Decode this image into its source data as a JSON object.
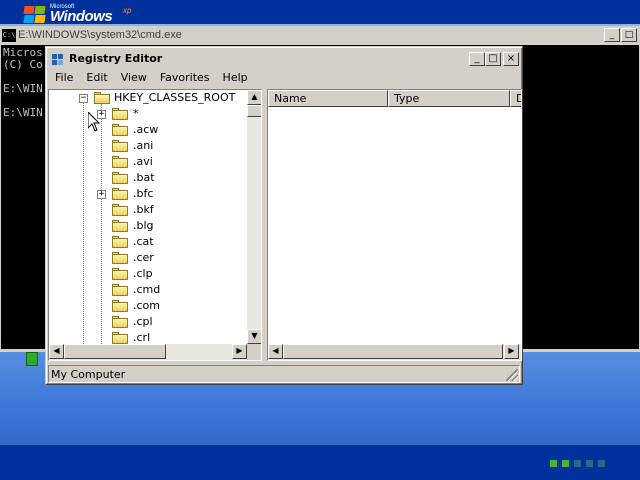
{
  "os": {
    "logo_small": "Microsoft",
    "logo_main": "Windows",
    "logo_suffix": "xp"
  },
  "cmd": {
    "icon_text": "C:\\",
    "title": "E:\\WINDOWS\\system32\\cmd.exe",
    "lines": [
      "Micros",
      "(C) Co",
      "",
      "E:\\WIN",
      "",
      "E:\\WIN"
    ]
  },
  "regedit": {
    "title": "Registry Editor",
    "controls": {
      "minimize": "_",
      "maximize": "□",
      "close": "×"
    },
    "menu": [
      "File",
      "Edit",
      "View",
      "Favorites",
      "Help"
    ],
    "tree": {
      "root": "HKEY_CLASSES_ROOT",
      "root_expander": "−",
      "items": [
        {
          "label": "*",
          "expander": "+"
        },
        {
          "label": ".acw",
          "expander": ""
        },
        {
          "label": ".ani",
          "expander": ""
        },
        {
          "label": ".avi",
          "expander": ""
        },
        {
          "label": ".bat",
          "expander": ""
        },
        {
          "label": ".bfc",
          "expander": "+"
        },
        {
          "label": ".bkf",
          "expander": ""
        },
        {
          "label": ".blg",
          "expander": ""
        },
        {
          "label": ".cat",
          "expander": ""
        },
        {
          "label": ".cer",
          "expander": ""
        },
        {
          "label": ".clp",
          "expander": ""
        },
        {
          "label": ".cmd",
          "expander": ""
        },
        {
          "label": ".com",
          "expander": ""
        },
        {
          "label": ".cpl",
          "expander": ""
        },
        {
          "label": ".crl",
          "expander": ""
        }
      ]
    },
    "list": {
      "columns": [
        "Name",
        "Type",
        "Data"
      ]
    },
    "status": "My Computer"
  },
  "setup_progress": {
    "filled": 2,
    "total": 5
  }
}
